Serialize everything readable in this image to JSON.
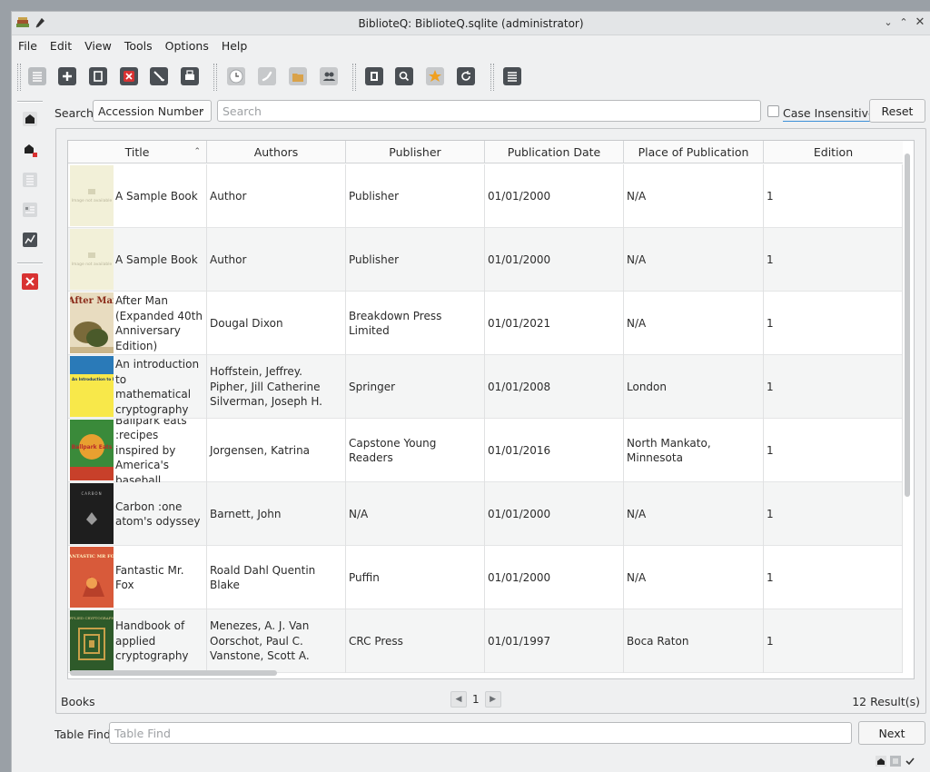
{
  "window": {
    "title": "BiblioteQ: BiblioteQ.sqlite (administrator)"
  },
  "menu": [
    "File",
    "Edit",
    "View",
    "Tools",
    "Options",
    "Help"
  ],
  "search": {
    "label": "Search",
    "field": "Accession Number",
    "placeholder": "Search",
    "case_label": "Case Insensitive",
    "reset_label": "Reset"
  },
  "table": {
    "columns": [
      "Title",
      "Authors",
      "Publisher",
      "Publication Date",
      "Place of Publication",
      "Edition"
    ],
    "rows": [
      {
        "title": "A Sample Book",
        "authors": "Author",
        "publisher": "Publisher",
        "date": "01/01/2000",
        "place": "N/A",
        "edition": "1",
        "cover": "placeholder",
        "cover_text": "Image not available"
      },
      {
        "title": "A Sample Book",
        "authors": "Author",
        "publisher": "Publisher",
        "date": "01/01/2000",
        "place": "N/A",
        "edition": "1",
        "cover": "placeholder",
        "cover_text": "Image not available"
      },
      {
        "title": "After Man (Expanded 40th Anniversary Edition)",
        "authors": "Dougal Dixon",
        "publisher": "Breakdown Press Limited",
        "date": "01/01/2021",
        "place": "N/A",
        "edition": "1",
        "cover": "afterman",
        "cover_text": "After Man"
      },
      {
        "title": "An introduction to mathematical cryptography",
        "authors": "Hoffstein, Jeffrey. Pipher, Jill Catherine Silverman, Joseph H.",
        "publisher": "Springer",
        "date": "01/01/2008",
        "place": "London",
        "edition": "1",
        "cover": "crypto",
        "cover_text": "An Introduction to Mathematical Cryptography"
      },
      {
        "title": "Ballpark eats :recipes inspired by America's baseball ...",
        "authors": "Jorgensen, Katrina",
        "publisher": "Capstone Young Readers",
        "date": "01/01/2016",
        "place": "North Mankato, Minnesota",
        "edition": "1",
        "cover": "ballpark",
        "cover_text": "Ballpark Eats"
      },
      {
        "title": "Carbon :one atom's odyssey",
        "authors": "Barnett, John",
        "publisher": "N/A",
        "date": "01/01/2000",
        "place": "N/A",
        "edition": "1",
        "cover": "carbon",
        "cover_text": "CARBON"
      },
      {
        "title": "Fantastic Mr. Fox",
        "authors": "Roald Dahl Quentin Blake",
        "publisher": "Puffin",
        "date": "01/01/2000",
        "place": "N/A",
        "edition": "1",
        "cover": "fox",
        "cover_text": "FANTASTIC MR FOX"
      },
      {
        "title": "Handbook of applied cryptography",
        "authors": "Menezes, A. J. Van Oorschot, Paul C. Vanstone, Scott A.",
        "publisher": "CRC Press",
        "date": "01/01/1997",
        "place": "Boca Raton",
        "edition": "1",
        "cover": "handbook",
        "cover_text": "APPLIED CRYPTOGRAPHY"
      }
    ],
    "sorted_column": "Title"
  },
  "footer": {
    "label": "Books",
    "page": "1",
    "results": "12 Result(s)"
  },
  "table_find": {
    "label": "Table Find",
    "placeholder": "Table Find",
    "next_label": "Next"
  },
  "colors": {
    "accent": "#3c8fd8",
    "delete_red": "#d83232",
    "toolbar_dark": "#4a4f54"
  }
}
